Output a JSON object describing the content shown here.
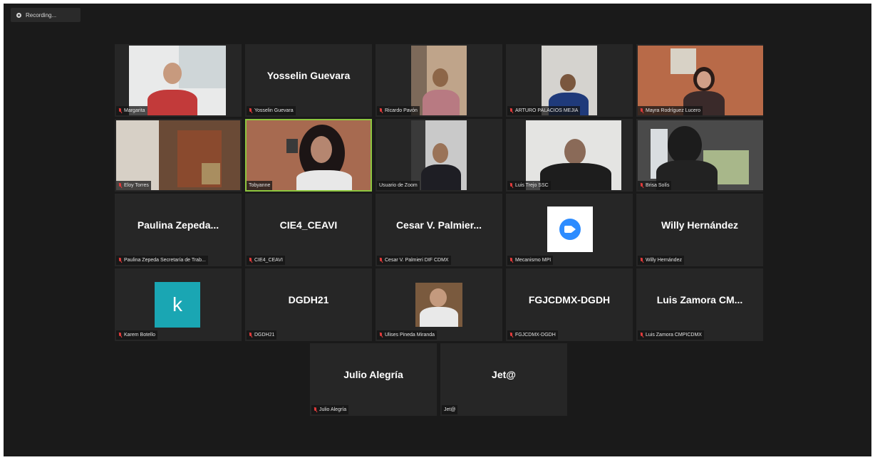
{
  "recording": {
    "label": "Recording..."
  },
  "participants": [
    {
      "label": "Margarita",
      "display": ""
    },
    {
      "label": "Yosselin Guevara",
      "display": "Yosselin Guevara"
    },
    {
      "label": "Ricardo Pavón",
      "display": ""
    },
    {
      "label": "ARTURO PALACIOS MEJIA",
      "display": ""
    },
    {
      "label": "Mayra Rodríguez Lucero",
      "display": ""
    },
    {
      "label": "Eloy Torres",
      "display": ""
    },
    {
      "label": "Tobyanne",
      "display": ""
    },
    {
      "label": "Usuario de Zoom",
      "display": ""
    },
    {
      "label": "Luis Trejo SSC",
      "display": ""
    },
    {
      "label": "Brisa Solís",
      "display": ""
    },
    {
      "label": "Paulina Zepeda Secretaría de Trab...",
      "display": "Paulina Zepeda..."
    },
    {
      "label": "CIE4_CEAVI",
      "display": "CIE4_CEAVI"
    },
    {
      "label": "Cesar V. Palmieri DIF CDMX",
      "display": "Cesar V. Palmier..."
    },
    {
      "label": "Mecanismo MPI",
      "display": ""
    },
    {
      "label": "Willy Hernández",
      "display": "Willy Hernández"
    },
    {
      "label": "Karem Botello",
      "display": "",
      "avatar_letter": "k"
    },
    {
      "label": "DGDH21",
      "display": "DGDH21"
    },
    {
      "label": "Ulises Pineda Miranda",
      "display": ""
    },
    {
      "label": "FGJCDMX-DGDH",
      "display": "FGJCDMX-DGDH"
    },
    {
      "label": "Luis Zamora CMPICDMX",
      "display": "Luis Zamora CM..."
    },
    {
      "label": "Julio Alegría",
      "display": "Julio Alegría"
    },
    {
      "label": "Jet@",
      "display": "Jet@"
    }
  ],
  "colors": {
    "active_speaker": "#8ec63f",
    "muted_icon": "#e03b3b",
    "zoom_blue": "#2d8cff",
    "avatar_teal": "#1aa6b3"
  }
}
